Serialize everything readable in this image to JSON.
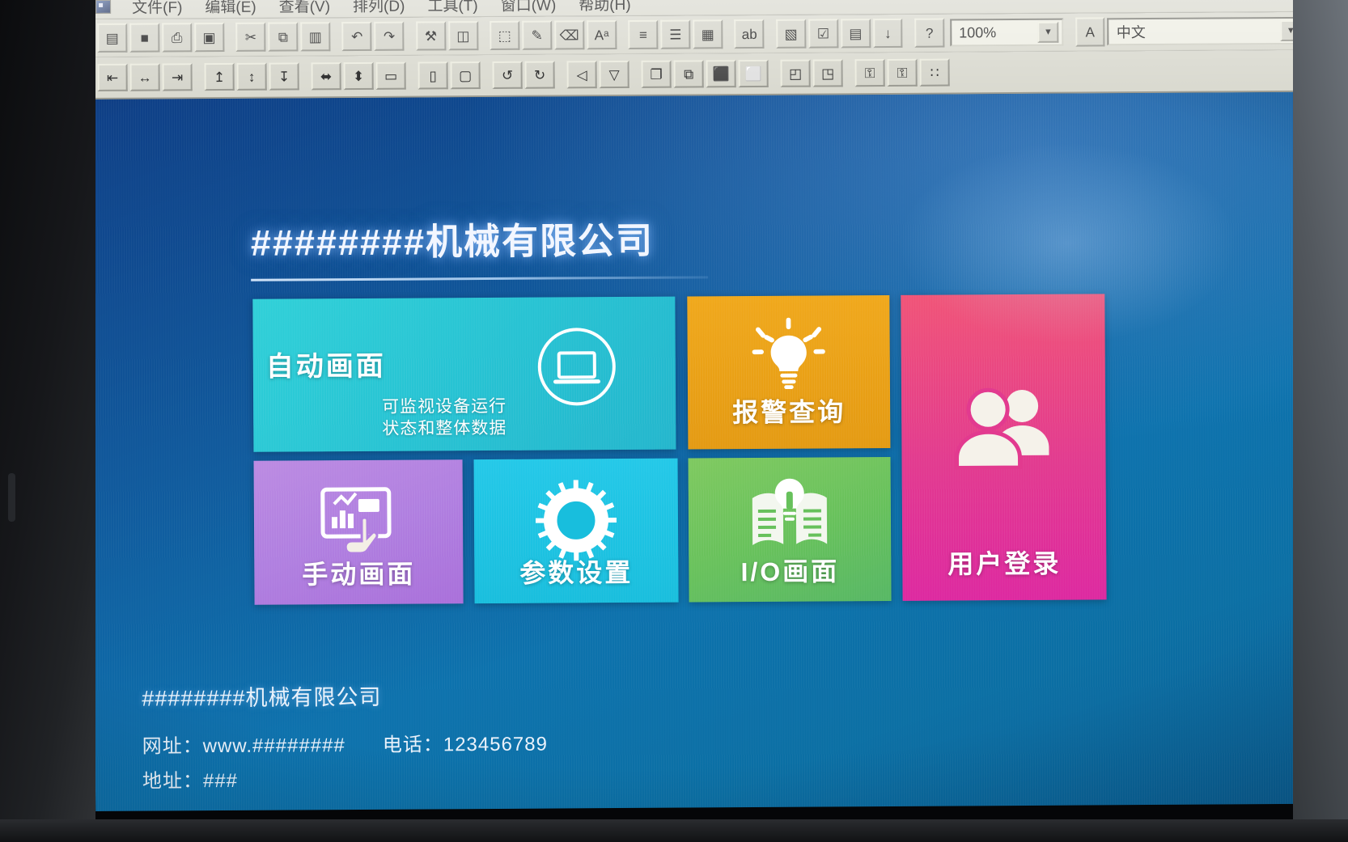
{
  "app": {
    "menu": [
      {
        "label": "文件(F)"
      },
      {
        "label": "编辑(E)"
      },
      {
        "label": "查看(V)"
      },
      {
        "label": "排列(D)"
      },
      {
        "label": "工具(T)"
      },
      {
        "label": "窗口(W)"
      },
      {
        "label": "帮助(H)"
      }
    ],
    "toolbar_row1": [
      {
        "name": "new-project-button",
        "glyph": "▤"
      },
      {
        "name": "save-button",
        "glyph": "■"
      },
      {
        "name": "print-button",
        "glyph": "⎙"
      },
      {
        "name": "print-preview-button",
        "glyph": "▣"
      },
      {
        "name": "cut-button",
        "glyph": "✂"
      },
      {
        "name": "copy-button",
        "glyph": "⧉"
      },
      {
        "name": "paste-button",
        "glyph": "▥"
      },
      {
        "name": "undo-button",
        "glyph": "↶"
      },
      {
        "name": "redo-button",
        "glyph": "↷"
      },
      {
        "name": "tools-button",
        "glyph": "⚒"
      },
      {
        "name": "library-button",
        "glyph": "◫"
      },
      {
        "name": "screen-add-button",
        "glyph": "⬚"
      },
      {
        "name": "screen-edit-button",
        "glyph": "✎"
      },
      {
        "name": "screen-delete-button",
        "glyph": "⌫"
      },
      {
        "name": "font-size-button",
        "glyph": "Aᵃ"
      },
      {
        "name": "align-justify-button",
        "glyph": "≡"
      },
      {
        "name": "align-left-button",
        "glyph": "☰"
      },
      {
        "name": "grid-button",
        "glyph": "▦"
      },
      {
        "name": "translate-button",
        "glyph": "ab"
      },
      {
        "name": "window-button",
        "glyph": "▧"
      },
      {
        "name": "check-button",
        "glyph": "☑"
      },
      {
        "name": "document-button",
        "glyph": "▤"
      },
      {
        "name": "download-button",
        "glyph": "↓"
      },
      {
        "name": "help-button",
        "glyph": "?"
      }
    ],
    "toolbar_row2": [
      {
        "name": "align-left-object-button",
        "glyph": "⇤"
      },
      {
        "name": "align-center-object-button",
        "glyph": "↔"
      },
      {
        "name": "align-right-object-button",
        "glyph": "⇥"
      },
      {
        "name": "align-top-object-button",
        "glyph": "↥"
      },
      {
        "name": "align-middle-object-button",
        "glyph": "↕"
      },
      {
        "name": "align-bottom-object-button",
        "glyph": "↧"
      },
      {
        "name": "distribute-horizontal-button",
        "glyph": "⬌"
      },
      {
        "name": "distribute-vertical-button",
        "glyph": "⬍"
      },
      {
        "name": "same-width-button",
        "glyph": "▭"
      },
      {
        "name": "same-height-button",
        "glyph": "▯"
      },
      {
        "name": "same-size-button",
        "glyph": "▢"
      },
      {
        "name": "rotate-left-button",
        "glyph": "↺"
      },
      {
        "name": "rotate-right-button",
        "glyph": "↻"
      },
      {
        "name": "flip-horizontal-button",
        "glyph": "◁"
      },
      {
        "name": "flip-vertical-button",
        "glyph": "▽"
      },
      {
        "name": "group-button",
        "glyph": "❐"
      },
      {
        "name": "ungroup-button",
        "glyph": "⧉"
      },
      {
        "name": "bring-front-button",
        "glyph": "⬛"
      },
      {
        "name": "send-back-button",
        "glyph": "⬜"
      },
      {
        "name": "bring-forward-button",
        "glyph": "◰"
      },
      {
        "name": "send-backward-button",
        "glyph": "◳"
      },
      {
        "name": "lock-button",
        "glyph": "⚿"
      },
      {
        "name": "unlock-button",
        "glyph": "⚿"
      },
      {
        "name": "dots-button",
        "glyph": "∷"
      }
    ],
    "zoom": {
      "value": "100%",
      "dropdown_icon": "▼"
    },
    "language": {
      "button_icon": "A",
      "value": "中文",
      "dropdown_icon": "▼"
    }
  },
  "hmi": {
    "title": "########机械有限公司",
    "tiles": [
      {
        "id": "auto-screen",
        "label": "自动画面",
        "sub_line1": "可监视设备运行",
        "sub_line2": "状态和整体数据",
        "icon": "monitor-icon",
        "color": "#27c3d3"
      },
      {
        "id": "alarm-query",
        "label": "报警查询",
        "icon": "lightbulb-icon",
        "color": "#e9a216"
      },
      {
        "id": "user-login",
        "label": "用户登录",
        "icon": "users-icon",
        "color": "#e23a8f"
      },
      {
        "id": "manual-screen",
        "label": "手动画面",
        "icon": "touch-panel-icon",
        "color": "#b07fe0"
      },
      {
        "id": "parameter-settings",
        "label": "参数设置",
        "icon": "gear-icon",
        "color": "#18bedd"
      },
      {
        "id": "io-screen",
        "label": "I/O画面",
        "icon": "book-bulb-icon",
        "color": "#67c15c"
      }
    ],
    "footer": {
      "company": "########机械有限公司",
      "website_label": "网址：",
      "website_value": "www.########",
      "phone_label": "电话：",
      "phone_value": "123456789",
      "address_label": "地址：",
      "address_value": "###"
    }
  }
}
